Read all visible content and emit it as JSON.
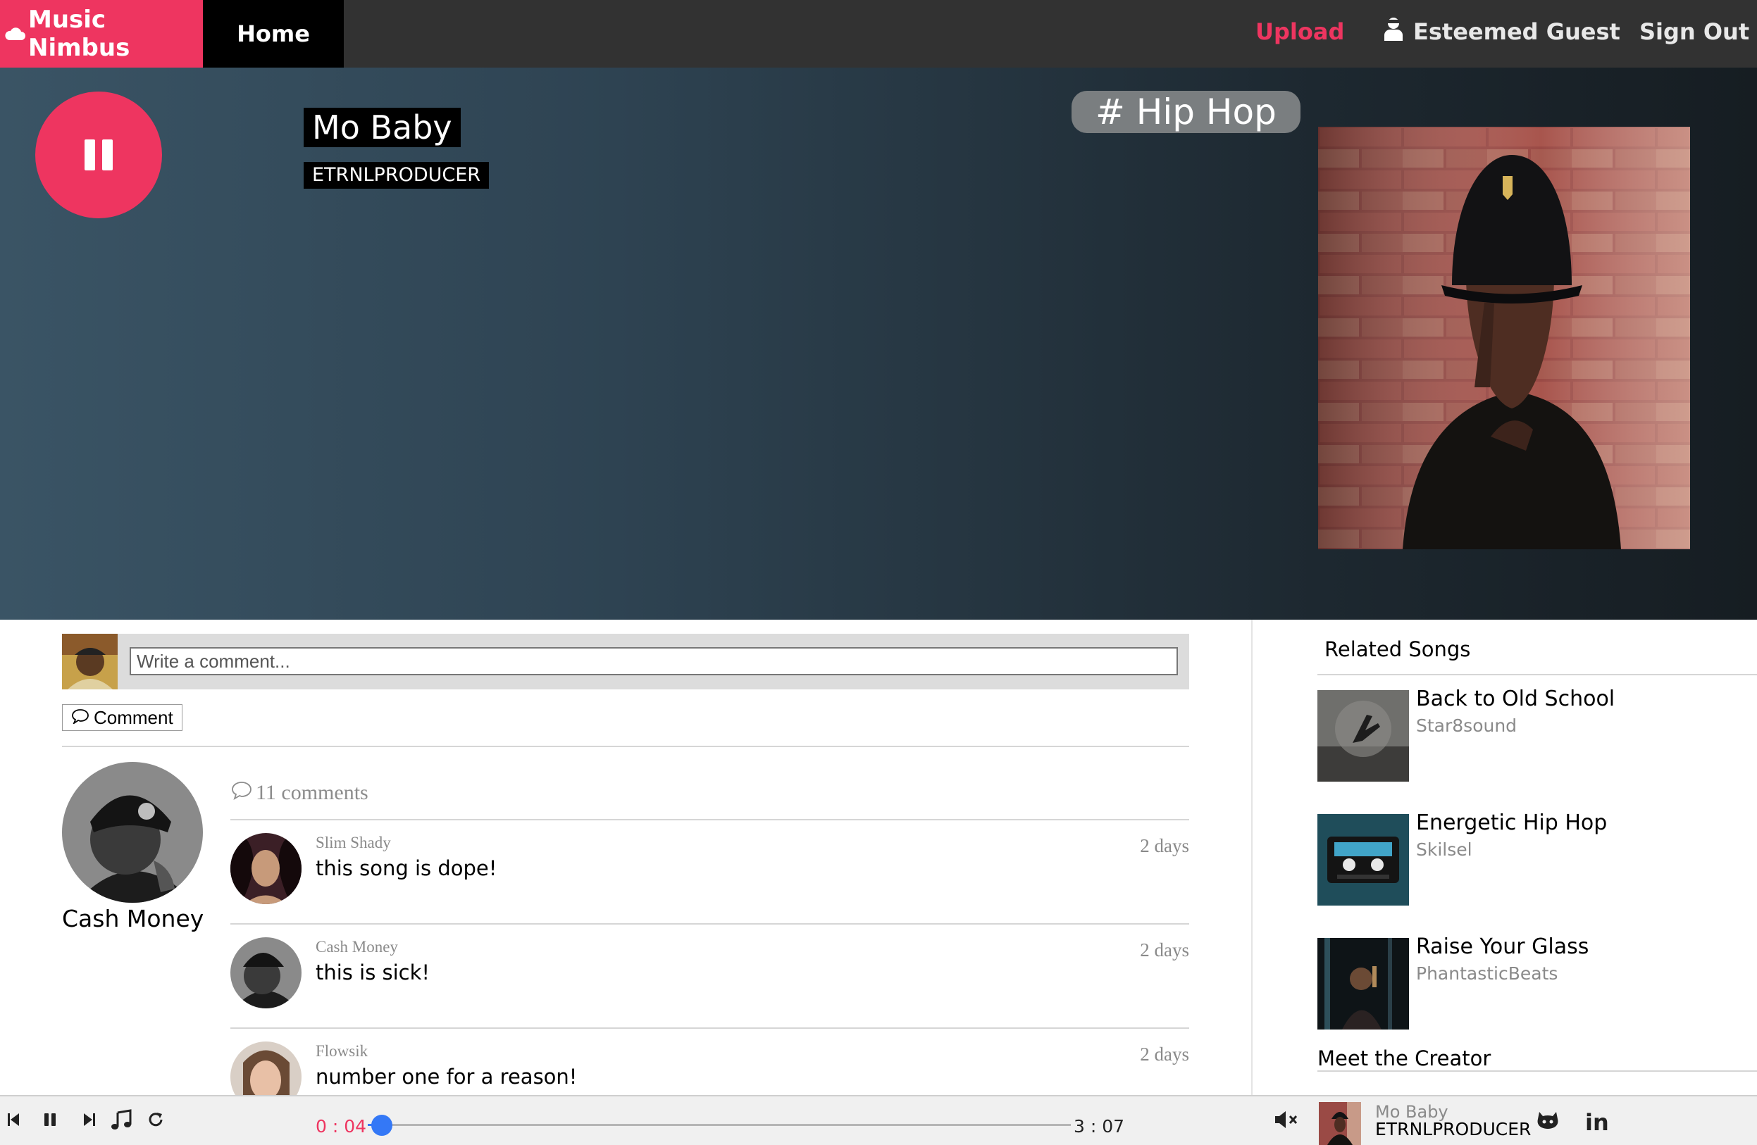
{
  "nav": {
    "brand": "Music Nimbus",
    "home": "Home",
    "upload": "Upload",
    "user": "Esteemed Guest",
    "signout": "Sign Out"
  },
  "song": {
    "title": "Mo Baby",
    "artist": "ETRNLPRODUCER",
    "genre": "# Hip Hop"
  },
  "comment_form": {
    "placeholder": "Write a comment...",
    "button": "Comment"
  },
  "uploader": {
    "name": "Cash Money"
  },
  "comments": {
    "count_label": "11 comments",
    "items": [
      {
        "user": "Slim Shady",
        "text": "this song is dope!",
        "time": "2 days"
      },
      {
        "user": "Cash Money",
        "text": "this is sick!",
        "time": "2 days"
      },
      {
        "user": "Flowsik",
        "text": "number one for a reason!",
        "time": "2 days"
      }
    ]
  },
  "sidebar": {
    "related_title": "Related Songs",
    "related": [
      {
        "title": "Back to Old School",
        "artist": "Star8sound"
      },
      {
        "title": "Energetic Hip Hop",
        "artist": "Skilsel"
      },
      {
        "title": "Raise Your Glass",
        "artist": "PhantasticBeats"
      }
    ],
    "meet_title": "Meet the Creator"
  },
  "player": {
    "current_time": "0 : 04",
    "total_time": "3 : 07",
    "progress": 0.02,
    "now_playing_title": "Mo Baby",
    "now_playing_artist": "ETRNLPRODUCER",
    "linkedin": "in"
  },
  "colors": {
    "accent": "#ee3560",
    "nav_bg": "#323232",
    "slider": "#3478f6"
  }
}
